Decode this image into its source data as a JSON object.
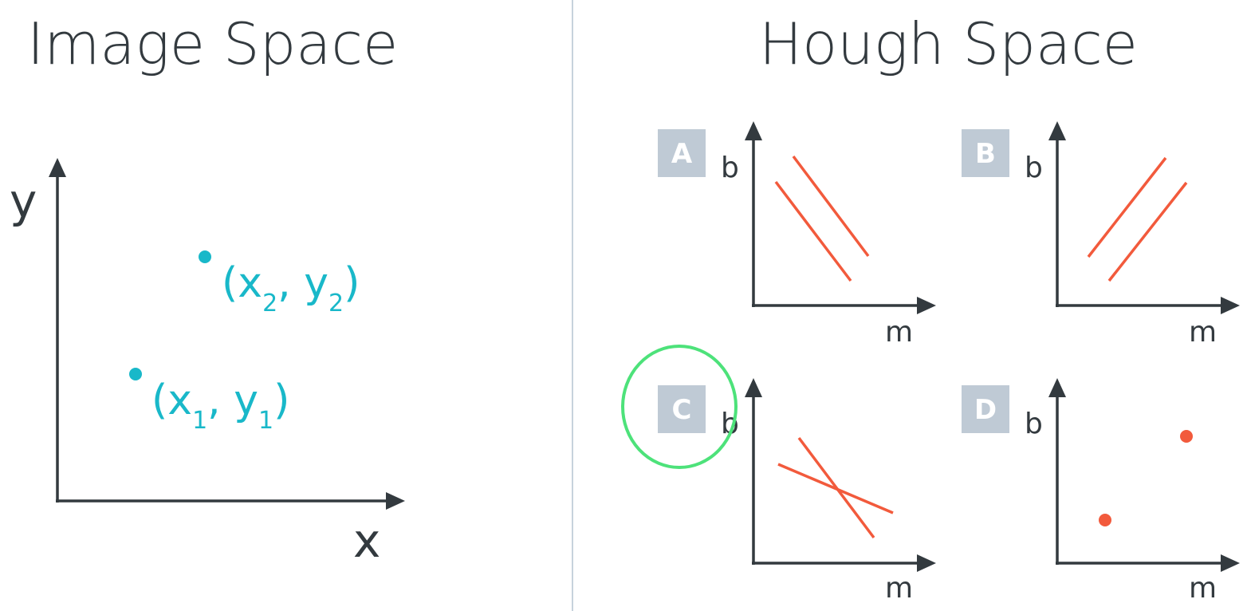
{
  "left": {
    "title": "Image Space",
    "x_label": "x",
    "y_label": "y",
    "points": [
      {
        "name": "x",
        "sub": "2",
        "name2": "y",
        "sub2": "2"
      },
      {
        "name": "x",
        "sub": "1",
        "name2": "y",
        "sub2": "1"
      }
    ],
    "point_color": "#19b8c9"
  },
  "right": {
    "title": "Hough Space",
    "x_label": "m",
    "y_label": "b",
    "line_color": "#f25a3c",
    "highlight_color": "#4de27a",
    "panels": [
      {
        "badge": "A",
        "kind": "parallel-down"
      },
      {
        "badge": "B",
        "kind": "parallel-up"
      },
      {
        "badge": "C",
        "kind": "intersecting",
        "selected": true
      },
      {
        "badge": "D",
        "kind": "two-points"
      }
    ]
  }
}
